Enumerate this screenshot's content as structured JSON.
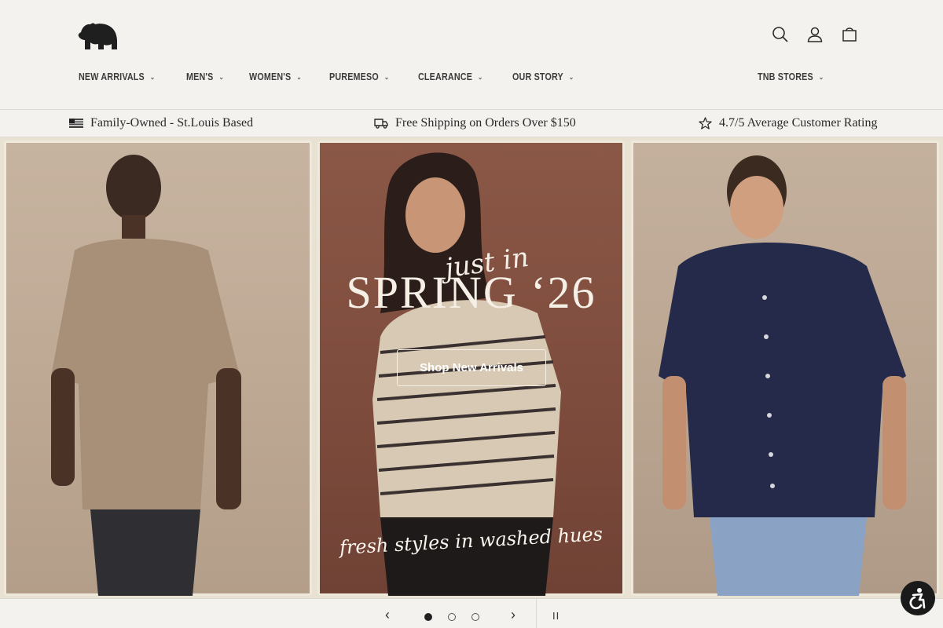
{
  "header": {
    "icons": [
      "bear-logo",
      "search-icon",
      "account-icon",
      "cart-icon"
    ],
    "nav": [
      {
        "label": "NEW ARRIVALS"
      },
      {
        "label": "MEN'S"
      },
      {
        "label": "WOMEN'S"
      },
      {
        "label": "PUREMESO"
      },
      {
        "label": "CLEARANCE"
      },
      {
        "label": "OUR STORY"
      }
    ],
    "nav_right": {
      "label": "TNB STORES"
    }
  },
  "benefits": [
    {
      "icon": "flag-icon",
      "text": "Family-Owned - St.Louis Based"
    },
    {
      "icon": "truck-icon",
      "text": "Free Shipping on Orders Over $150"
    },
    {
      "icon": "star-icon",
      "text": "4.7/5 Average Customer Rating"
    }
  ],
  "hero": {
    "script_title": "just in",
    "headline": "SPRING ‘26",
    "cta_label": "Shop New Arrivals",
    "tagline": "fresh styles in washed hues"
  },
  "carousel": {
    "prev_symbol": "‹",
    "next_symbol": "›",
    "pause_symbol": "II",
    "slide_count": 3,
    "active_slide": 1
  },
  "colors": {
    "background": "#f3f2ee",
    "panel_left": "#c7b4a0",
    "panel_center": "#8b5847",
    "panel_right": "#c4b19d",
    "text": "#2a2a2a"
  }
}
